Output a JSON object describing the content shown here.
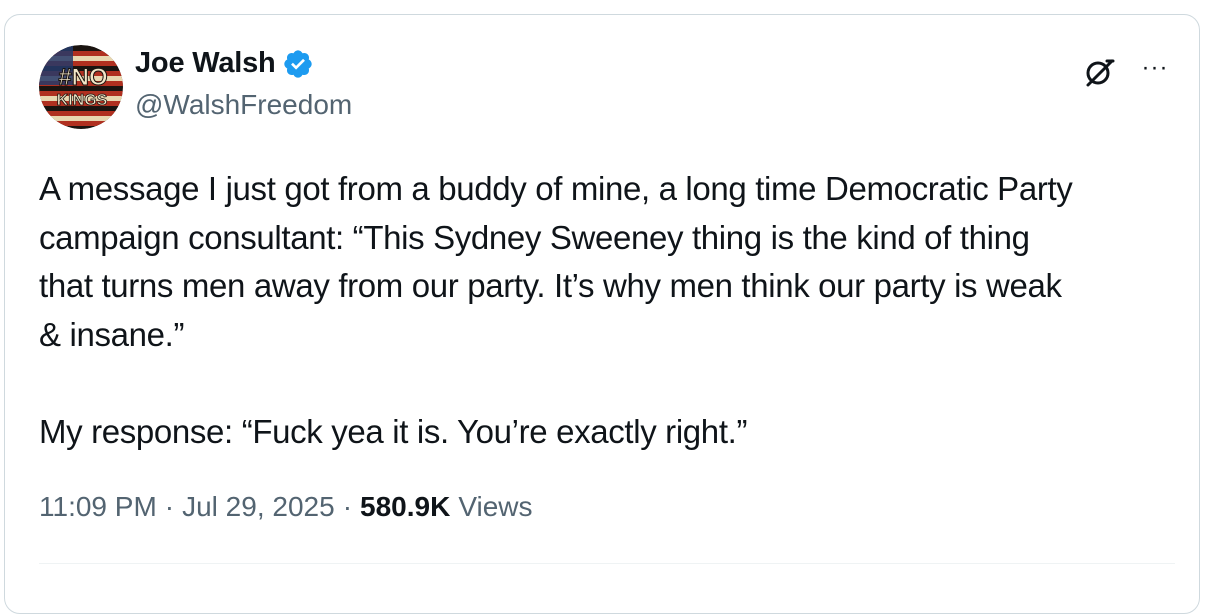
{
  "author": {
    "display_name": "Joe Walsh",
    "handle": "@WalshFreedom",
    "avatar_text_line1": "#NO",
    "avatar_text_line2": "KINGS",
    "verified": true
  },
  "icons": {
    "verified": "verified-badge-icon",
    "grok": "grok-icon",
    "more": "more-options-icon"
  },
  "more_label": "···",
  "tweet": {
    "text": "A message I just got from a buddy of mine, a long time Democratic Party\ncampaign consultant: “This Sydney Sweeney thing is the kind of thing\nthat turns men away from our party. It’s why men think our party is weak\n& insane.”\n\nMy response: “Fuck yea it is. You’re exactly right.”"
  },
  "meta": {
    "time": "11:09 PM",
    "separator": "·",
    "date": "Jul 29, 2025",
    "views_count": "580.9K",
    "views_label": "Views"
  },
  "colors": {
    "verified_blue": "#1d9bf0",
    "secondary_text": "#536471",
    "primary_text": "#0f1419"
  }
}
